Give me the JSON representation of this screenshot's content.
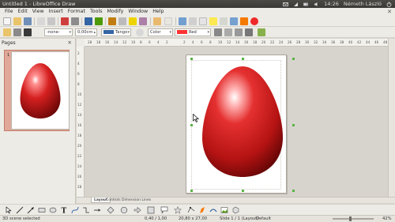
{
  "window": {
    "title": "Untitled 1 - LibreOffice Draw",
    "clock": "14:26",
    "user": "Németh László"
  },
  "menu": {
    "items": [
      "File",
      "Edit",
      "View",
      "Insert",
      "Format",
      "Tools",
      "Modify",
      "Window",
      "Help"
    ]
  },
  "format_toolbar": {
    "line_style": "-none-",
    "line_width": "0,00cm",
    "line_color": "Tango",
    "area_style": "Color",
    "area_color": "Red",
    "line_color_hex": "#3465a4",
    "area_color_hex": "#ff3333"
  },
  "pages_pane": {
    "title": "Pages",
    "page_number": "1"
  },
  "ruler": {
    "h_ticks": [
      "28",
      "18",
      "16",
      "14",
      "12",
      "10",
      "8",
      "6",
      "4",
      "2",
      "",
      "2",
      "4",
      "6",
      "8",
      "10",
      "12",
      "14",
      "16",
      "18",
      "20",
      "22",
      "24",
      "26",
      "28",
      "30",
      "32",
      "34",
      "36",
      "38",
      "40",
      "42",
      "44",
      "46",
      "48"
    ],
    "v_ticks": [
      "2",
      "4",
      "6",
      "8",
      "10",
      "12",
      "14",
      "16",
      "18",
      "20",
      "22",
      "24",
      "26",
      "28"
    ]
  },
  "tabs": [
    "Layout",
    "Controls",
    "Dimension Lines"
  ],
  "status": {
    "selection": "3D scene selected",
    "position": "0,40 / 1,00",
    "size": "20,80 x 27,00",
    "page": "Slide 1 / 1 (Layout)",
    "master": "Default",
    "zoom": "42%",
    "zoom_fraction": 0.42
  },
  "colors": {
    "egg": "#cc1a1a",
    "accent": "#5cb346"
  }
}
